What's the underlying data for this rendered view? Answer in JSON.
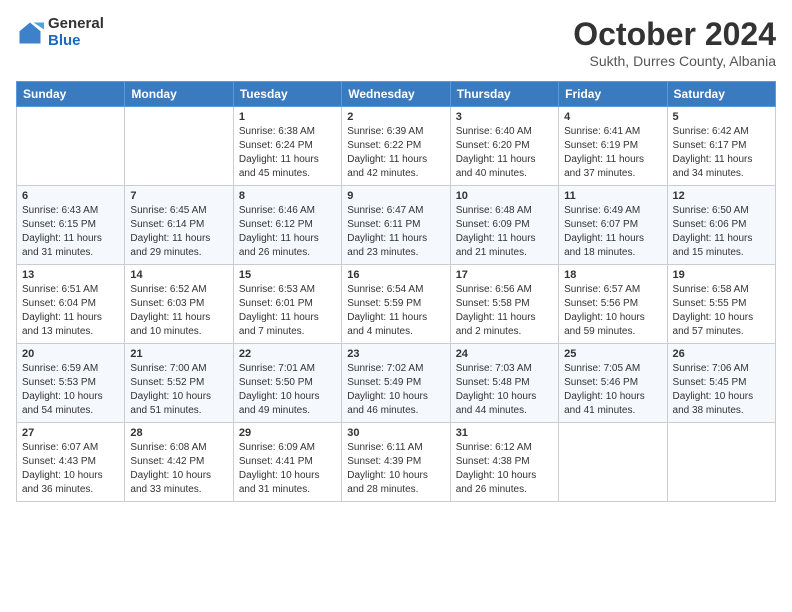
{
  "logo": {
    "general": "General",
    "blue": "Blue"
  },
  "title": "October 2024",
  "subtitle": "Sukth, Durres County, Albania",
  "days_of_week": [
    "Sunday",
    "Monday",
    "Tuesday",
    "Wednesday",
    "Thursday",
    "Friday",
    "Saturday"
  ],
  "weeks": [
    [
      {
        "day": "",
        "sunrise": "",
        "sunset": "",
        "daylight": ""
      },
      {
        "day": "",
        "sunrise": "",
        "sunset": "",
        "daylight": ""
      },
      {
        "day": "1",
        "sunrise": "Sunrise: 6:38 AM",
        "sunset": "Sunset: 6:24 PM",
        "daylight": "Daylight: 11 hours and 45 minutes."
      },
      {
        "day": "2",
        "sunrise": "Sunrise: 6:39 AM",
        "sunset": "Sunset: 6:22 PM",
        "daylight": "Daylight: 11 hours and 42 minutes."
      },
      {
        "day": "3",
        "sunrise": "Sunrise: 6:40 AM",
        "sunset": "Sunset: 6:20 PM",
        "daylight": "Daylight: 11 hours and 40 minutes."
      },
      {
        "day": "4",
        "sunrise": "Sunrise: 6:41 AM",
        "sunset": "Sunset: 6:19 PM",
        "daylight": "Daylight: 11 hours and 37 minutes."
      },
      {
        "day": "5",
        "sunrise": "Sunrise: 6:42 AM",
        "sunset": "Sunset: 6:17 PM",
        "daylight": "Daylight: 11 hours and 34 minutes."
      }
    ],
    [
      {
        "day": "6",
        "sunrise": "Sunrise: 6:43 AM",
        "sunset": "Sunset: 6:15 PM",
        "daylight": "Daylight: 11 hours and 31 minutes."
      },
      {
        "day": "7",
        "sunrise": "Sunrise: 6:45 AM",
        "sunset": "Sunset: 6:14 PM",
        "daylight": "Daylight: 11 hours and 29 minutes."
      },
      {
        "day": "8",
        "sunrise": "Sunrise: 6:46 AM",
        "sunset": "Sunset: 6:12 PM",
        "daylight": "Daylight: 11 hours and 26 minutes."
      },
      {
        "day": "9",
        "sunrise": "Sunrise: 6:47 AM",
        "sunset": "Sunset: 6:11 PM",
        "daylight": "Daylight: 11 hours and 23 minutes."
      },
      {
        "day": "10",
        "sunrise": "Sunrise: 6:48 AM",
        "sunset": "Sunset: 6:09 PM",
        "daylight": "Daylight: 11 hours and 21 minutes."
      },
      {
        "day": "11",
        "sunrise": "Sunrise: 6:49 AM",
        "sunset": "Sunset: 6:07 PM",
        "daylight": "Daylight: 11 hours and 18 minutes."
      },
      {
        "day": "12",
        "sunrise": "Sunrise: 6:50 AM",
        "sunset": "Sunset: 6:06 PM",
        "daylight": "Daylight: 11 hours and 15 minutes."
      }
    ],
    [
      {
        "day": "13",
        "sunrise": "Sunrise: 6:51 AM",
        "sunset": "Sunset: 6:04 PM",
        "daylight": "Daylight: 11 hours and 13 minutes."
      },
      {
        "day": "14",
        "sunrise": "Sunrise: 6:52 AM",
        "sunset": "Sunset: 6:03 PM",
        "daylight": "Daylight: 11 hours and 10 minutes."
      },
      {
        "day": "15",
        "sunrise": "Sunrise: 6:53 AM",
        "sunset": "Sunset: 6:01 PM",
        "daylight": "Daylight: 11 hours and 7 minutes."
      },
      {
        "day": "16",
        "sunrise": "Sunrise: 6:54 AM",
        "sunset": "Sunset: 5:59 PM",
        "daylight": "Daylight: 11 hours and 4 minutes."
      },
      {
        "day": "17",
        "sunrise": "Sunrise: 6:56 AM",
        "sunset": "Sunset: 5:58 PM",
        "daylight": "Daylight: 11 hours and 2 minutes."
      },
      {
        "day": "18",
        "sunrise": "Sunrise: 6:57 AM",
        "sunset": "Sunset: 5:56 PM",
        "daylight": "Daylight: 10 hours and 59 minutes."
      },
      {
        "day": "19",
        "sunrise": "Sunrise: 6:58 AM",
        "sunset": "Sunset: 5:55 PM",
        "daylight": "Daylight: 10 hours and 57 minutes."
      }
    ],
    [
      {
        "day": "20",
        "sunrise": "Sunrise: 6:59 AM",
        "sunset": "Sunset: 5:53 PM",
        "daylight": "Daylight: 10 hours and 54 minutes."
      },
      {
        "day": "21",
        "sunrise": "Sunrise: 7:00 AM",
        "sunset": "Sunset: 5:52 PM",
        "daylight": "Daylight: 10 hours and 51 minutes."
      },
      {
        "day": "22",
        "sunrise": "Sunrise: 7:01 AM",
        "sunset": "Sunset: 5:50 PM",
        "daylight": "Daylight: 10 hours and 49 minutes."
      },
      {
        "day": "23",
        "sunrise": "Sunrise: 7:02 AM",
        "sunset": "Sunset: 5:49 PM",
        "daylight": "Daylight: 10 hours and 46 minutes."
      },
      {
        "day": "24",
        "sunrise": "Sunrise: 7:03 AM",
        "sunset": "Sunset: 5:48 PM",
        "daylight": "Daylight: 10 hours and 44 minutes."
      },
      {
        "day": "25",
        "sunrise": "Sunrise: 7:05 AM",
        "sunset": "Sunset: 5:46 PM",
        "daylight": "Daylight: 10 hours and 41 minutes."
      },
      {
        "day": "26",
        "sunrise": "Sunrise: 7:06 AM",
        "sunset": "Sunset: 5:45 PM",
        "daylight": "Daylight: 10 hours and 38 minutes."
      }
    ],
    [
      {
        "day": "27",
        "sunrise": "Sunrise: 6:07 AM",
        "sunset": "Sunset: 4:43 PM",
        "daylight": "Daylight: 10 hours and 36 minutes."
      },
      {
        "day": "28",
        "sunrise": "Sunrise: 6:08 AM",
        "sunset": "Sunset: 4:42 PM",
        "daylight": "Daylight: 10 hours and 33 minutes."
      },
      {
        "day": "29",
        "sunrise": "Sunrise: 6:09 AM",
        "sunset": "Sunset: 4:41 PM",
        "daylight": "Daylight: 10 hours and 31 minutes."
      },
      {
        "day": "30",
        "sunrise": "Sunrise: 6:11 AM",
        "sunset": "Sunset: 4:39 PM",
        "daylight": "Daylight: 10 hours and 28 minutes."
      },
      {
        "day": "31",
        "sunrise": "Sunrise: 6:12 AM",
        "sunset": "Sunset: 4:38 PM",
        "daylight": "Daylight: 10 hours and 26 minutes."
      },
      {
        "day": "",
        "sunrise": "",
        "sunset": "",
        "daylight": ""
      },
      {
        "day": "",
        "sunrise": "",
        "sunset": "",
        "daylight": ""
      }
    ]
  ]
}
